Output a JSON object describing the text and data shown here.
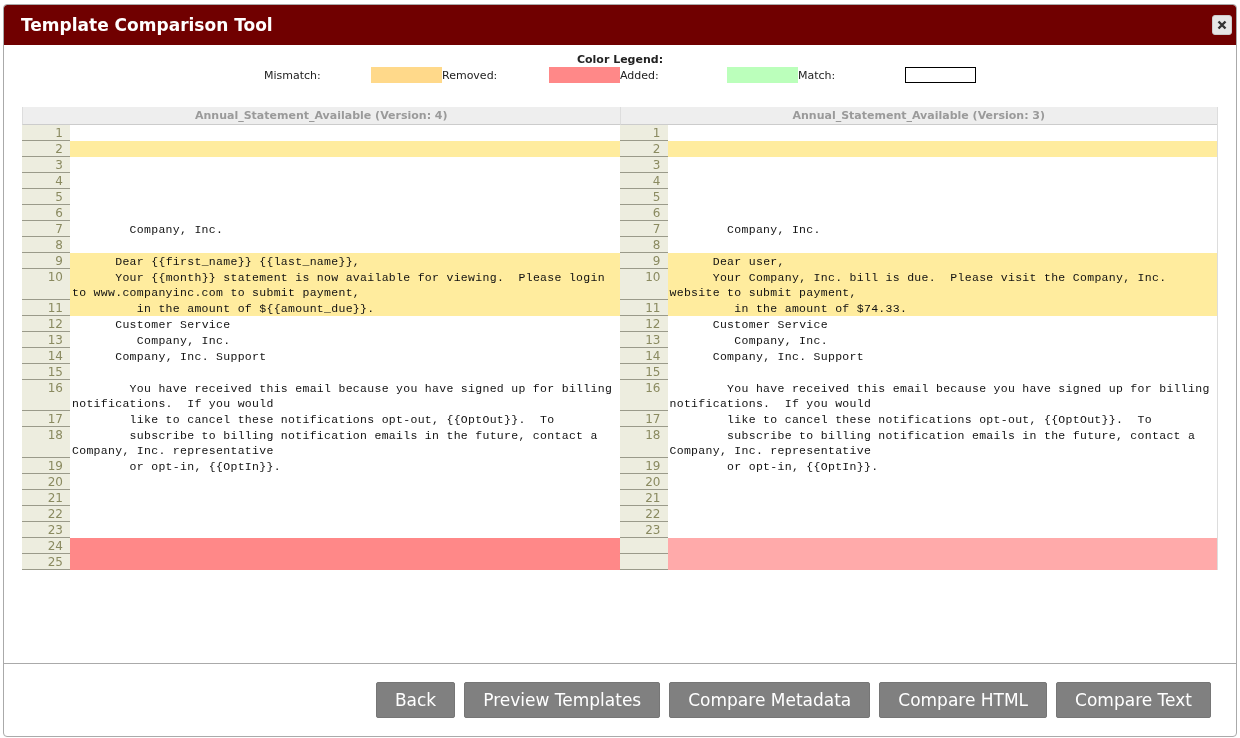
{
  "window": {
    "title": "Template Comparison Tool"
  },
  "legend": {
    "title": "Color Legend:",
    "items": [
      {
        "label": "Mismatch:",
        "color": "#ffd98a"
      },
      {
        "label": "Removed:",
        "color": "#ff8888"
      },
      {
        "label": "Added:",
        "color": "#bbffbb"
      },
      {
        "label": "Match:",
        "color": "#ffffff"
      }
    ]
  },
  "panes": [
    {
      "title": "Annual_Statement_Available (Version: 4)",
      "rows": [
        {
          "number": "1",
          "kind": "match"
        },
        {
          "number": "2",
          "kind": "mismatch"
        },
        {
          "number": "3",
          "kind": "match"
        },
        {
          "number": "4",
          "kind": "match"
        },
        {
          "number": "5",
          "kind": "match"
        },
        {
          "number": "6",
          "kind": "match"
        },
        {
          "number": "7",
          "kind": "match",
          "text": "        Company, Inc."
        },
        {
          "number": "8",
          "kind": "match"
        },
        {
          "number": "9",
          "kind": "mismatch",
          "text": "      Dear {{first_name}} {{last_name}},"
        },
        {
          "number": "10",
          "kind": "mismatch",
          "text": "      Your {{month}} statement is now available for viewing.  Please login to www.companyinc.com to submit payment,"
        },
        {
          "number": "11",
          "kind": "mismatch",
          "text": "         in the amount of ${{amount_due}}."
        },
        {
          "number": "12",
          "kind": "match",
          "text": "      Customer Service"
        },
        {
          "number": "13",
          "kind": "match",
          "text": "         Company, Inc."
        },
        {
          "number": "14",
          "kind": "match",
          "text": "      Company, Inc. Support"
        },
        {
          "number": "15",
          "kind": "match"
        },
        {
          "number": "16",
          "kind": "match",
          "text": "        You have received this email because you have signed up for billing notifications.  If you would"
        },
        {
          "number": "17",
          "kind": "match",
          "text": "        like to cancel these notifications opt-out, {{OptOut}}.  To"
        },
        {
          "number": "18",
          "kind": "match",
          "text": "        subscribe to billing notification emails in the future, contact a Company, Inc. representative"
        },
        {
          "number": "19",
          "kind": "match",
          "text": "        or opt-in, {{OptIn}}."
        },
        {
          "number": "20",
          "kind": "match"
        },
        {
          "number": "21",
          "kind": "match"
        },
        {
          "number": "22",
          "kind": "match"
        },
        {
          "number": "23",
          "kind": "match"
        },
        {
          "number": "24",
          "kind": "removed"
        },
        {
          "number": "25",
          "kind": "removed"
        }
      ]
    },
    {
      "title": "Annual_Statement_Available (Version: 3)",
      "rows": [
        {
          "number": "1",
          "kind": "match"
        },
        {
          "number": "2",
          "kind": "mismatch"
        },
        {
          "number": "3",
          "kind": "match"
        },
        {
          "number": "4",
          "kind": "match"
        },
        {
          "number": "5",
          "kind": "match"
        },
        {
          "number": "6",
          "kind": "match"
        },
        {
          "number": "7",
          "kind": "match",
          "text": "        Company, Inc."
        },
        {
          "number": "8",
          "kind": "match"
        },
        {
          "number": "9",
          "kind": "mismatch",
          "text": "      Dear user,"
        },
        {
          "number": "10",
          "kind": "mismatch",
          "text": "      Your Company, Inc. bill is due.  Please visit the Company, Inc. website to submit payment,"
        },
        {
          "number": "11",
          "kind": "mismatch",
          "text": "         in the amount of $74.33."
        },
        {
          "number": "12",
          "kind": "match",
          "text": "      Customer Service"
        },
        {
          "number": "13",
          "kind": "match",
          "text": "         Company, Inc."
        },
        {
          "number": "14",
          "kind": "match",
          "text": "      Company, Inc. Support"
        },
        {
          "number": "15",
          "kind": "match"
        },
        {
          "number": "16",
          "kind": "match",
          "text": "        You have received this email because you have signed up for billing notifications.  If you would"
        },
        {
          "number": "17",
          "kind": "match",
          "text": "        like to cancel these notifications opt-out, {{OptOut}}.  To"
        },
        {
          "number": "18",
          "kind": "match",
          "text": "        subscribe to billing notification emails in the future, contact a Company, Inc. representative"
        },
        {
          "number": "19",
          "kind": "match",
          "text": "        or opt-in, {{OptIn}}."
        },
        {
          "number": "20",
          "kind": "match"
        },
        {
          "number": "21",
          "kind": "match"
        },
        {
          "number": "22",
          "kind": "match"
        },
        {
          "number": "23",
          "kind": "match"
        },
        {
          "kind": "missing"
        },
        {
          "kind": "missing"
        }
      ]
    }
  ],
  "buttons": [
    "Back",
    "Preview Templates",
    "Compare Metadata",
    "Compare HTML",
    "Compare Text"
  ]
}
